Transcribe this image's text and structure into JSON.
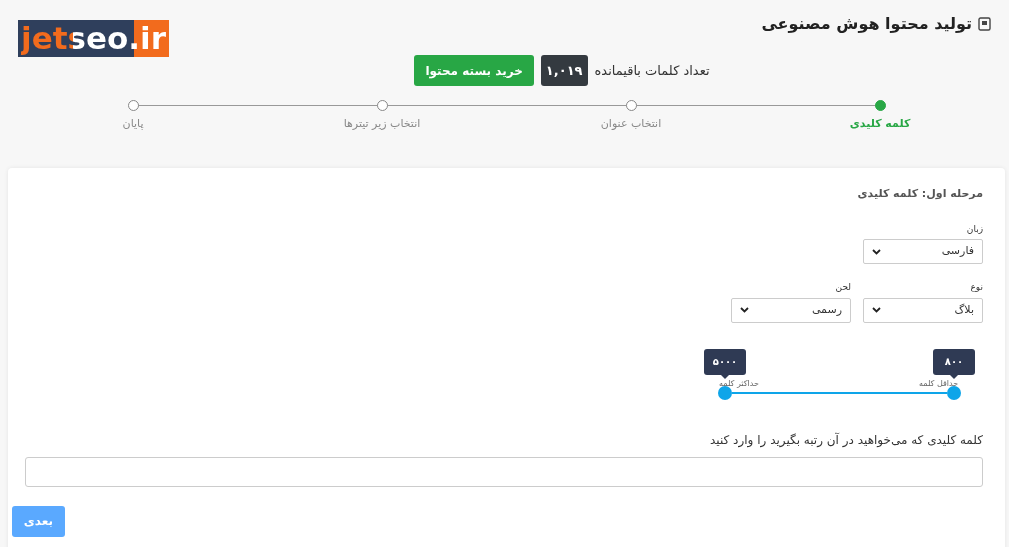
{
  "page_title": "تولید محتوا هوش مصنوعی",
  "logo": "jetseo.ir",
  "credits": {
    "label": "تعداد کلمات باقیمانده",
    "count": "۱,۰۱۹",
    "buy_button": "خرید بسته محتوا"
  },
  "steps": [
    {
      "label": "کلمه کلیدی",
      "selected": true
    },
    {
      "label": "انتخاب عنوان",
      "selected": false
    },
    {
      "label": "انتخاب زیر تیترها",
      "selected": false
    },
    {
      "label": "پایان",
      "selected": false
    }
  ],
  "card": {
    "heading": "مرحله اول: کلمه کلیدی",
    "language": {
      "label": "زبان",
      "value": "فارسی"
    },
    "type": {
      "label": "نوع",
      "value": "بلاگ"
    },
    "tone": {
      "label": "لحن",
      "value": "رسمی"
    },
    "word_range": [
      {
        "tooltip": "۸۰۰",
        "label": "حداقل کلمه"
      },
      {
        "tooltip": "۵۰۰۰",
        "label": "حداکثر کلمه"
      }
    ],
    "keyword": {
      "label": "کلمه کلیدی که می‌خواهید در آن رتبه بگیرید را وارد کنید"
    },
    "next_button": {
      "label": "بعدی",
      "disabled": true
    }
  }
}
